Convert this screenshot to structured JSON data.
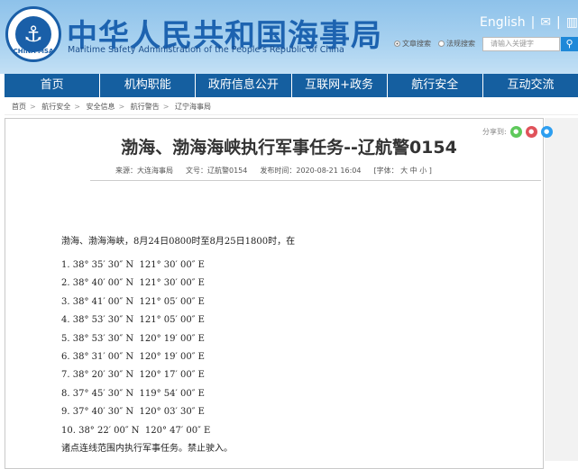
{
  "header": {
    "logo_text": "CHINA MSA",
    "title_cn": "中华人民共和国海事局",
    "title_en": "Maritime Safety Administration of the People's Republic of China",
    "english_link": "English",
    "search_options": [
      "文章搜索",
      "法规搜索"
    ],
    "search_placeholder": "请输入关键字"
  },
  "nav": [
    "首页",
    "机构职能",
    "政府信息公开",
    "互联网+政务",
    "航行安全",
    "互动交流"
  ],
  "breadcrumb": [
    "首页",
    "航行安全",
    "安全信息",
    "航行警告",
    "辽宁海事局"
  ],
  "share_label": "分享到:",
  "article": {
    "title": "渤海、渤海海峡执行军事任务--辽航警0154",
    "source": "来源：大连海事局",
    "doc_no": "文号：辽航警0154",
    "published": "发布时间：2020-08-21 16:04",
    "font_size": "[字体： 大  中  小 ]",
    "intro": "渤海、渤海海峡，8月24日0800时至8月25日1800时，在",
    "points": [
      "1. 38° 35′ 30″ N  121° 30′ 00″ E",
      "2. 38° 40′ 00″ N  121° 30′ 00″ E",
      "3. 38° 41′ 00″ N  121° 05′ 00″ E",
      "4. 38° 53′ 30″ N  121° 05′ 00″ E",
      "5. 38° 53′ 30″ N  120° 19′ 00″ E",
      "6. 38° 31′ 00″ N  120° 19′ 00″ E",
      "7. 38° 20′ 30″ N  120° 17′ 00″ E",
      "8. 37° 45′ 30″ N  119° 54′ 00″ E",
      "9. 37° 40′ 30″ N  120° 03′ 30″ E",
      "10. 38° 22′ 00″ N  120° 47′ 00″ E"
    ],
    "outro": "诸点连线范围内执行军事任务。禁止驶入。"
  }
}
